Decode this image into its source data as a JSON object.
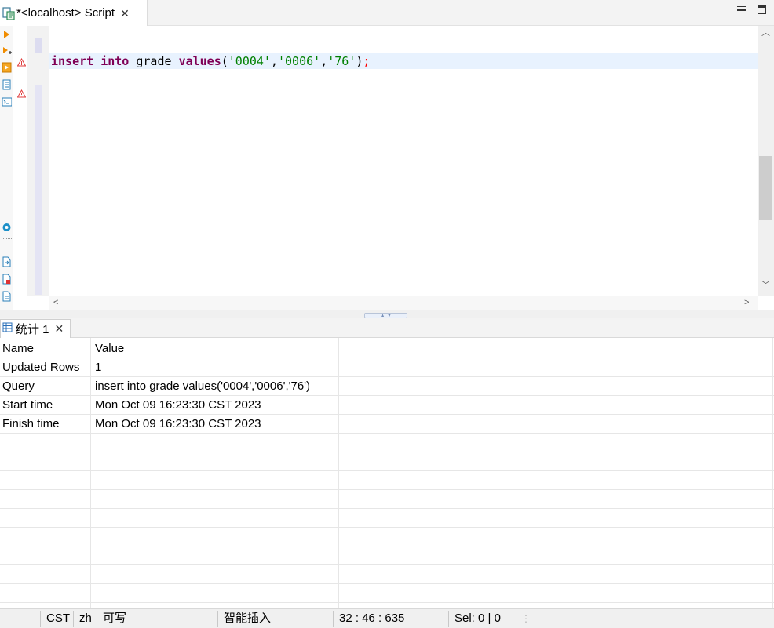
{
  "tab": {
    "title": "*<localhost> Script",
    "close": "✕"
  },
  "editor": {
    "code_tokens": [
      {
        "text": "insert",
        "style": "kw"
      },
      {
        "text": " ",
        "style": "plain"
      },
      {
        "text": "into",
        "style": "kw"
      },
      {
        "text": " grade ",
        "style": "plain"
      },
      {
        "text": "values",
        "style": "kw"
      },
      {
        "text": "(",
        "style": "plain"
      },
      {
        "text": "'0004'",
        "style": "str"
      },
      {
        "text": ",",
        "style": "plain"
      },
      {
        "text": "'0006'",
        "style": "str"
      },
      {
        "text": ",",
        "style": "plain"
      },
      {
        "text": "'76'",
        "style": "str"
      },
      {
        "text": ")",
        "style": "plain"
      },
      {
        "text": ";",
        "style": "err"
      }
    ]
  },
  "results": {
    "tab_title": "统计 1",
    "tab_close": "✕",
    "columns": [
      "Name",
      "Value"
    ],
    "rows": [
      {
        "name": "Updated Rows",
        "value": "1"
      },
      {
        "name": "Query",
        "value": "insert into grade values('0004','0006','76')"
      },
      {
        "name": "Start time",
        "value": "Mon Oct 09 16:23:30 CST 2023"
      },
      {
        "name": "Finish time",
        "value": "Mon Oct 09 16:23:30 CST 2023"
      }
    ]
  },
  "status": {
    "timezone": "CST",
    "locale": "zh",
    "mode": "可写",
    "insert_mode": "智能插入",
    "position": "32 : 46 : 635",
    "selection": "Sel: 0 | 0"
  },
  "colors": {
    "keyword": "#7f0055",
    "string": "#008000",
    "current_line": "#e8f2fe",
    "error": "#ff0000"
  }
}
